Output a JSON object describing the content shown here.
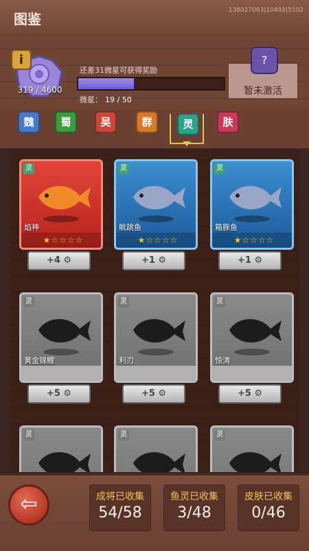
{
  "header": {
    "title": "图鉴",
    "uid": "138027063|10492|5102"
  },
  "info": {
    "badge": "i",
    "gem_count": "319 / 4600",
    "hint": "还差31微星可获得奖励",
    "progress_label": "微星：",
    "progress_text": "19 / 50",
    "progress_fraction": 0.38,
    "reward_icon": "?",
    "reward_status": "暂未激活"
  },
  "tabs": [
    {
      "label": "魏",
      "color": "#4a78c8"
    },
    {
      "label": "蜀",
      "color": "#3e9a3e"
    },
    {
      "label": "吴",
      "color": "#c8463a"
    },
    {
      "label": "群",
      "color": "#d77a2a"
    },
    {
      "label": "灵",
      "color": "#2fa08a",
      "selected": true
    },
    {
      "label": "肤",
      "color": "#c83a5a"
    }
  ],
  "cards": [
    {
      "tag": "灵",
      "name": "焰神",
      "stars": "★☆☆☆☆",
      "btn": "+4 ⚙",
      "theme": "red"
    },
    {
      "tag": "灵",
      "name": "眺跳鱼",
      "stars": "★☆☆☆☆",
      "btn": "+1 ⚙",
      "theme": "blue"
    },
    {
      "tag": "灵",
      "name": "箱豚鱼",
      "stars": "★☆☆☆☆",
      "btn": "+1 ⚙",
      "theme": "blue"
    },
    {
      "tag": "灵",
      "name": "黄金锦鲤",
      "stars": "",
      "btn": "+5 ⚙",
      "theme": "gray"
    },
    {
      "tag": "灵",
      "name": "利刃",
      "stars": "",
      "btn": "+5 ⚙",
      "theme": "gray"
    },
    {
      "tag": "灵",
      "name": "惊涛",
      "stars": "",
      "btn": "+5 ⚙",
      "theme": "gray"
    },
    {
      "tag": "灵",
      "name": "",
      "stars": "",
      "btn": "",
      "theme": "gray"
    },
    {
      "tag": "灵",
      "name": "",
      "stars": "",
      "btn": "",
      "theme": "gray"
    },
    {
      "tag": "灵",
      "name": "",
      "stars": "",
      "btn": "",
      "theme": "gray"
    }
  ],
  "footer": {
    "back_icon": "⇦",
    "stats": [
      {
        "label": "成将已收集",
        "value": "54/58"
      },
      {
        "label": "鱼灵已收集",
        "value": "3/48"
      },
      {
        "label": "皮肤已收集",
        "value": "0/46"
      }
    ]
  },
  "icons": {
    "info": "info-icon",
    "gem": "purple-gem-icon",
    "reward": "reward-chest-icon",
    "back": "back-arrow-icon",
    "gear": "gear-icon",
    "star": "star-icon"
  }
}
